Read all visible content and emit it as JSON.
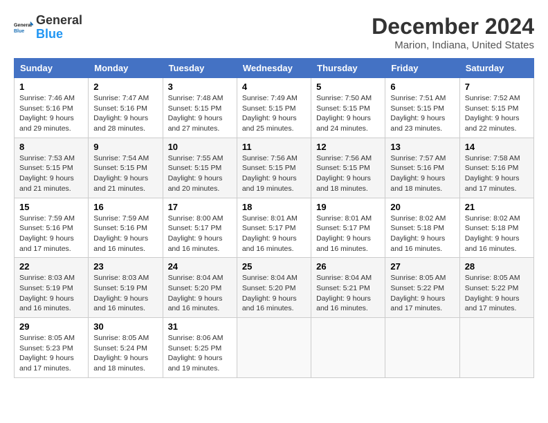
{
  "logo": {
    "line1": "General",
    "line2": "Blue"
  },
  "title": "December 2024",
  "location": "Marion, Indiana, United States",
  "days_header": [
    "Sunday",
    "Monday",
    "Tuesday",
    "Wednesday",
    "Thursday",
    "Friday",
    "Saturday"
  ],
  "weeks": [
    [
      {
        "day": "1",
        "sunrise": "Sunrise: 7:46 AM",
        "sunset": "Sunset: 5:16 PM",
        "daylight": "Daylight: 9 hours and 29 minutes."
      },
      {
        "day": "2",
        "sunrise": "Sunrise: 7:47 AM",
        "sunset": "Sunset: 5:16 PM",
        "daylight": "Daylight: 9 hours and 28 minutes."
      },
      {
        "day": "3",
        "sunrise": "Sunrise: 7:48 AM",
        "sunset": "Sunset: 5:15 PM",
        "daylight": "Daylight: 9 hours and 27 minutes."
      },
      {
        "day": "4",
        "sunrise": "Sunrise: 7:49 AM",
        "sunset": "Sunset: 5:15 PM",
        "daylight": "Daylight: 9 hours and 25 minutes."
      },
      {
        "day": "5",
        "sunrise": "Sunrise: 7:50 AM",
        "sunset": "Sunset: 5:15 PM",
        "daylight": "Daylight: 9 hours and 24 minutes."
      },
      {
        "day": "6",
        "sunrise": "Sunrise: 7:51 AM",
        "sunset": "Sunset: 5:15 PM",
        "daylight": "Daylight: 9 hours and 23 minutes."
      },
      {
        "day": "7",
        "sunrise": "Sunrise: 7:52 AM",
        "sunset": "Sunset: 5:15 PM",
        "daylight": "Daylight: 9 hours and 22 minutes."
      }
    ],
    [
      {
        "day": "8",
        "sunrise": "Sunrise: 7:53 AM",
        "sunset": "Sunset: 5:15 PM",
        "daylight": "Daylight: 9 hours and 21 minutes."
      },
      {
        "day": "9",
        "sunrise": "Sunrise: 7:54 AM",
        "sunset": "Sunset: 5:15 PM",
        "daylight": "Daylight: 9 hours and 21 minutes."
      },
      {
        "day": "10",
        "sunrise": "Sunrise: 7:55 AM",
        "sunset": "Sunset: 5:15 PM",
        "daylight": "Daylight: 9 hours and 20 minutes."
      },
      {
        "day": "11",
        "sunrise": "Sunrise: 7:56 AM",
        "sunset": "Sunset: 5:15 PM",
        "daylight": "Daylight: 9 hours and 19 minutes."
      },
      {
        "day": "12",
        "sunrise": "Sunrise: 7:56 AM",
        "sunset": "Sunset: 5:15 PM",
        "daylight": "Daylight: 9 hours and 18 minutes."
      },
      {
        "day": "13",
        "sunrise": "Sunrise: 7:57 AM",
        "sunset": "Sunset: 5:16 PM",
        "daylight": "Daylight: 9 hours and 18 minutes."
      },
      {
        "day": "14",
        "sunrise": "Sunrise: 7:58 AM",
        "sunset": "Sunset: 5:16 PM",
        "daylight": "Daylight: 9 hours and 17 minutes."
      }
    ],
    [
      {
        "day": "15",
        "sunrise": "Sunrise: 7:59 AM",
        "sunset": "Sunset: 5:16 PM",
        "daylight": "Daylight: 9 hours and 17 minutes."
      },
      {
        "day": "16",
        "sunrise": "Sunrise: 7:59 AM",
        "sunset": "Sunset: 5:16 PM",
        "daylight": "Daylight: 9 hours and 16 minutes."
      },
      {
        "day": "17",
        "sunrise": "Sunrise: 8:00 AM",
        "sunset": "Sunset: 5:17 PM",
        "daylight": "Daylight: 9 hours and 16 minutes."
      },
      {
        "day": "18",
        "sunrise": "Sunrise: 8:01 AM",
        "sunset": "Sunset: 5:17 PM",
        "daylight": "Daylight: 9 hours and 16 minutes."
      },
      {
        "day": "19",
        "sunrise": "Sunrise: 8:01 AM",
        "sunset": "Sunset: 5:17 PM",
        "daylight": "Daylight: 9 hours and 16 minutes."
      },
      {
        "day": "20",
        "sunrise": "Sunrise: 8:02 AM",
        "sunset": "Sunset: 5:18 PM",
        "daylight": "Daylight: 9 hours and 16 minutes."
      },
      {
        "day": "21",
        "sunrise": "Sunrise: 8:02 AM",
        "sunset": "Sunset: 5:18 PM",
        "daylight": "Daylight: 9 hours and 16 minutes."
      }
    ],
    [
      {
        "day": "22",
        "sunrise": "Sunrise: 8:03 AM",
        "sunset": "Sunset: 5:19 PM",
        "daylight": "Daylight: 9 hours and 16 minutes."
      },
      {
        "day": "23",
        "sunrise": "Sunrise: 8:03 AM",
        "sunset": "Sunset: 5:19 PM",
        "daylight": "Daylight: 9 hours and 16 minutes."
      },
      {
        "day": "24",
        "sunrise": "Sunrise: 8:04 AM",
        "sunset": "Sunset: 5:20 PM",
        "daylight": "Daylight: 9 hours and 16 minutes."
      },
      {
        "day": "25",
        "sunrise": "Sunrise: 8:04 AM",
        "sunset": "Sunset: 5:20 PM",
        "daylight": "Daylight: 9 hours and 16 minutes."
      },
      {
        "day": "26",
        "sunrise": "Sunrise: 8:04 AM",
        "sunset": "Sunset: 5:21 PM",
        "daylight": "Daylight: 9 hours and 16 minutes."
      },
      {
        "day": "27",
        "sunrise": "Sunrise: 8:05 AM",
        "sunset": "Sunset: 5:22 PM",
        "daylight": "Daylight: 9 hours and 17 minutes."
      },
      {
        "day": "28",
        "sunrise": "Sunrise: 8:05 AM",
        "sunset": "Sunset: 5:22 PM",
        "daylight": "Daylight: 9 hours and 17 minutes."
      }
    ],
    [
      {
        "day": "29",
        "sunrise": "Sunrise: 8:05 AM",
        "sunset": "Sunset: 5:23 PM",
        "daylight": "Daylight: 9 hours and 17 minutes."
      },
      {
        "day": "30",
        "sunrise": "Sunrise: 8:05 AM",
        "sunset": "Sunset: 5:24 PM",
        "daylight": "Daylight: 9 hours and 18 minutes."
      },
      {
        "day": "31",
        "sunrise": "Sunrise: 8:06 AM",
        "sunset": "Sunset: 5:25 PM",
        "daylight": "Daylight: 9 hours and 19 minutes."
      },
      null,
      null,
      null,
      null
    ]
  ]
}
